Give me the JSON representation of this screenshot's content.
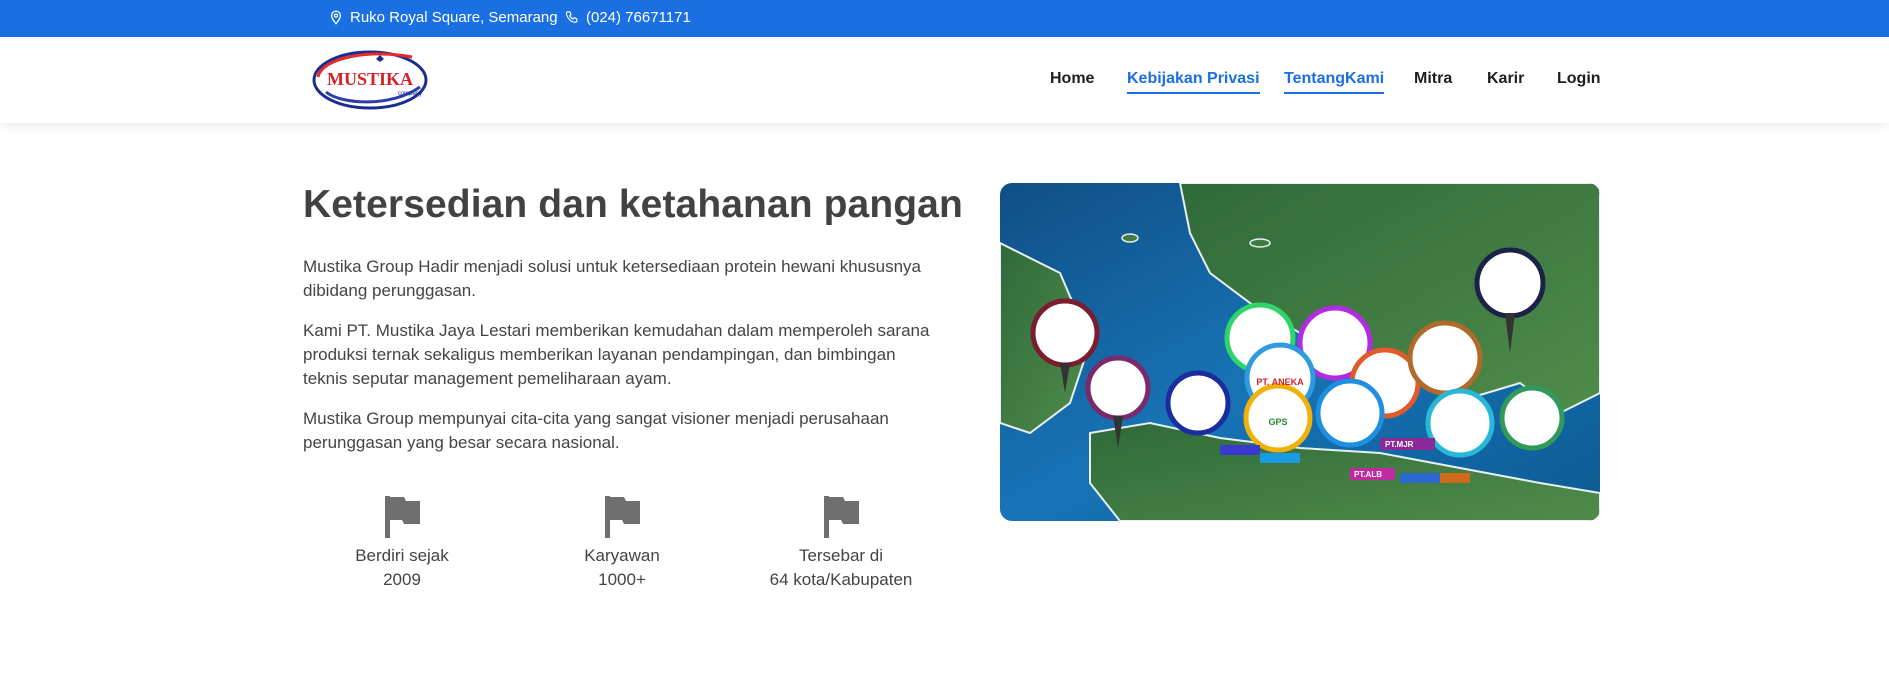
{
  "topbar": {
    "address": "Ruko Royal Square, Semarang",
    "phone": "(024) 76671171",
    "background_color": "#1a6fe3"
  },
  "logo": {
    "text": "MUSTIKA",
    "subtext": "company"
  },
  "nav": {
    "items": [
      {
        "label": "Home",
        "active": false
      },
      {
        "label": "Kebijakan Privasi",
        "active": true
      },
      {
        "label": "TentangKami",
        "active": true
      },
      {
        "label": "Mitra",
        "active": false
      },
      {
        "label": "Karir",
        "active": false
      },
      {
        "label": "Login",
        "active": false
      }
    ],
    "accent_color": "#1a6fe3"
  },
  "hero": {
    "title": "Ketersedian dan ketahanan pangan",
    "paragraphs": [
      "Mustika Group Hadir menjadi solusi untuk ketersediaan protein hewani khususnya dibidang perunggasan.",
      "Kami PT. Mustika Jaya Lestari memberikan kemudahan dalam memperoleh sarana produksi ternak sekaligus memberikan layanan pendampingan, dan bimbingan teknis seputar management pemeliharaan ayam.",
      "Mustika Group mempunyai cita-cita yang sangat visioner menjadi perusahaan perunggasan yang besar secara nasional."
    ]
  },
  "stats": [
    {
      "icon": "flag-icon",
      "line1": "Berdiri sejak",
      "line2": "2009"
    },
    {
      "icon": "flag-icon",
      "line1": "Karyawan",
      "line2": "1000+"
    },
    {
      "icon": "flag-icon",
      "line1": "Tersebar di",
      "line2": "64 kota/Kabupaten"
    }
  ],
  "map_image": {
    "icon": "partner-map-image",
    "labels": [
      "PT. ANEKA",
      "GPS",
      "PT.MJR",
      "PT.ALB"
    ]
  }
}
